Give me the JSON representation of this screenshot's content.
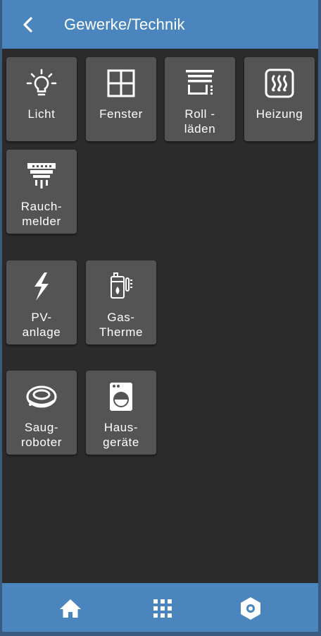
{
  "header": {
    "title": "Gewerke/Technik",
    "back_icon": "chevron-left-icon"
  },
  "tiles": [
    {
      "label1": "Licht",
      "label2": "",
      "icon": "light-bulb-icon"
    },
    {
      "label1": "Fenster",
      "label2": "",
      "icon": "window-icon"
    },
    {
      "label1": "Roll -",
      "label2": "läden",
      "icon": "roller-shutter-icon"
    },
    {
      "label1": "Heizung",
      "label2": "",
      "icon": "heating-icon"
    },
    {
      "label1": "Rauch-",
      "label2": "melder",
      "icon": "smoke-detector-icon"
    },
    {
      "label1": "PV-",
      "label2": "anlage",
      "icon": "lightning-icon"
    },
    {
      "label1": "Gas-",
      "label2": "Therme",
      "icon": "gas-boiler-icon"
    },
    {
      "label1": "Saug-",
      "label2": "roboter",
      "icon": "robot-vacuum-icon"
    },
    {
      "label1": "Haus-",
      "label2": "geräte",
      "icon": "washing-machine-icon"
    }
  ],
  "footer": {
    "items": [
      {
        "icon": "home-icon"
      },
      {
        "icon": "grid-icon"
      },
      {
        "icon": "settings-icon"
      }
    ]
  },
  "colors": {
    "header": "#4a86bd",
    "background": "#2b2b2b",
    "tile": "#545454",
    "text": "#ffffff"
  }
}
